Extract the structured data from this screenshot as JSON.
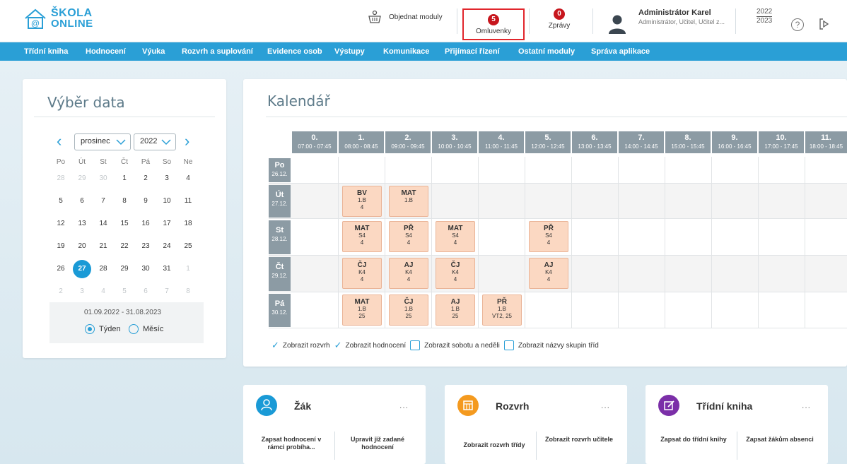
{
  "header": {
    "logo_line1": "ŠKOLA",
    "logo_line2": "ONLINE",
    "order_modules": "Objednat moduly",
    "omluvenky_count": "5",
    "omluvenky_label": "Omluvenky",
    "zpravy_count": "0",
    "zpravy_label": "Zprávy",
    "user_name": "Administrátor Karel",
    "user_role": "Administrátor, Učitel, Učitel z...",
    "year_from": "2022",
    "year_to": "2023",
    "help": "?"
  },
  "nav": [
    "Třídní kniha",
    "Hodnocení",
    "Výuka",
    "Rozvrh a suplování",
    "Evidence osob",
    "Výstupy",
    "Komunikace",
    "Přijímací řízení",
    "Ostatní moduly",
    "Správa aplikace"
  ],
  "datepicker": {
    "title": "Výběr data",
    "month": "prosinec",
    "year": "2022",
    "dow": [
      "Po",
      "Út",
      "St",
      "Čt",
      "Pá",
      "So",
      "Ne"
    ],
    "weeks": [
      [
        "28",
        "29",
        "30",
        "1",
        "2",
        "3",
        "4"
      ],
      [
        "5",
        "6",
        "7",
        "8",
        "9",
        "10",
        "11"
      ],
      [
        "12",
        "13",
        "14",
        "15",
        "16",
        "17",
        "18"
      ],
      [
        "19",
        "20",
        "21",
        "22",
        "23",
        "24",
        "25"
      ],
      [
        "26",
        "27",
        "28",
        "29",
        "30",
        "31",
        "1"
      ],
      [
        "2",
        "3",
        "4",
        "5",
        "6",
        "7",
        "8"
      ]
    ],
    "selected_day": "27",
    "range": "01.09.2022 - 31.08.2023",
    "view_week": "Týden",
    "view_month": "Měsíc"
  },
  "calendar": {
    "title": "Kalendář",
    "periods": [
      {
        "num": "0.",
        "time": "07:00 - 07:45"
      },
      {
        "num": "1.",
        "time": "08:00 - 08:45"
      },
      {
        "num": "2.",
        "time": "09:00 - 09:45"
      },
      {
        "num": "3.",
        "time": "10:00 - 10:45"
      },
      {
        "num": "4.",
        "time": "11:00 - 11:45"
      },
      {
        "num": "5.",
        "time": "12:00 - 12:45"
      },
      {
        "num": "6.",
        "time": "13:00 - 13:45"
      },
      {
        "num": "7.",
        "time": "14:00 - 14:45"
      },
      {
        "num": "8.",
        "time": "15:00 - 15:45"
      },
      {
        "num": "9.",
        "time": "16:00 - 16:45"
      },
      {
        "num": "10.",
        "time": "17:00 - 17:45"
      },
      {
        "num": "11.",
        "time": "18:00 - 18:45"
      }
    ],
    "days": [
      {
        "day": "Po",
        "date": "26.12."
      },
      {
        "day": "Út",
        "date": "27.12."
      },
      {
        "day": "St",
        "date": "28.12."
      },
      {
        "day": "Čt",
        "date": "29.12."
      },
      {
        "day": "Pá",
        "date": "30.12."
      }
    ],
    "lessons": [
      {
        "row": 1,
        "col": 1,
        "subject": "BV",
        "class": "1.B",
        "room": "4"
      },
      {
        "row": 1,
        "col": 2,
        "subject": "MAT",
        "class": "1.B",
        "room": ""
      },
      {
        "row": 2,
        "col": 1,
        "subject": "MAT",
        "class": "S4",
        "room": "4"
      },
      {
        "row": 2,
        "col": 2,
        "subject": "PŘ",
        "class": "S4",
        "room": "4"
      },
      {
        "row": 2,
        "col": 3,
        "subject": "MAT",
        "class": "S4",
        "room": "4"
      },
      {
        "row": 2,
        "col": 5,
        "subject": "PŘ",
        "class": "S4",
        "room": "4"
      },
      {
        "row": 3,
        "col": 1,
        "subject": "ČJ",
        "class": "K4",
        "room": "4"
      },
      {
        "row": 3,
        "col": 2,
        "subject": "AJ",
        "class": "K4",
        "room": "4"
      },
      {
        "row": 3,
        "col": 3,
        "subject": "ČJ",
        "class": "K4",
        "room": "4"
      },
      {
        "row": 3,
        "col": 5,
        "subject": "AJ",
        "class": "K4",
        "room": "4"
      },
      {
        "row": 4,
        "col": 1,
        "subject": "MAT",
        "class": "1.B",
        "room": "25"
      },
      {
        "row": 4,
        "col": 2,
        "subject": "ČJ",
        "class": "1.B",
        "room": "25"
      },
      {
        "row": 4,
        "col": 3,
        "subject": "AJ",
        "class": "1.B",
        "room": "25"
      },
      {
        "row": 4,
        "col": 4,
        "subject": "PŘ",
        "class": "1.B",
        "room": "VT2, 25"
      }
    ],
    "options": [
      {
        "label": "Zobrazit rozvrh",
        "checked": true
      },
      {
        "label": "Zobrazit hodnocení",
        "checked": true
      },
      {
        "label": "Zobrazit sobotu a neděli",
        "checked": false
      },
      {
        "label": "Zobrazit názvy skupin tříd",
        "checked": false
      }
    ]
  },
  "cards": [
    {
      "title": "Žák",
      "dots": "...",
      "color": "#1a9ad6",
      "icon": "student-icon",
      "link1": "Zapsat hodnocení v rámci probíha...",
      "link2": "Upravit již zadané hodnocení"
    },
    {
      "title": "Rozvrh",
      "dots": "...",
      "color": "#f49a1f",
      "icon": "schedule-icon",
      "link1": "Zobrazit rozvrh třídy",
      "link2": "Zobrazit rozvrh učitele"
    },
    {
      "title": "Třídní kniha",
      "dots": "...",
      "color": "#7b2fa8",
      "icon": "class-book-icon",
      "link1": "Zapsat do třídní knihy",
      "link2": "Zapsat žákům absenci"
    }
  ]
}
